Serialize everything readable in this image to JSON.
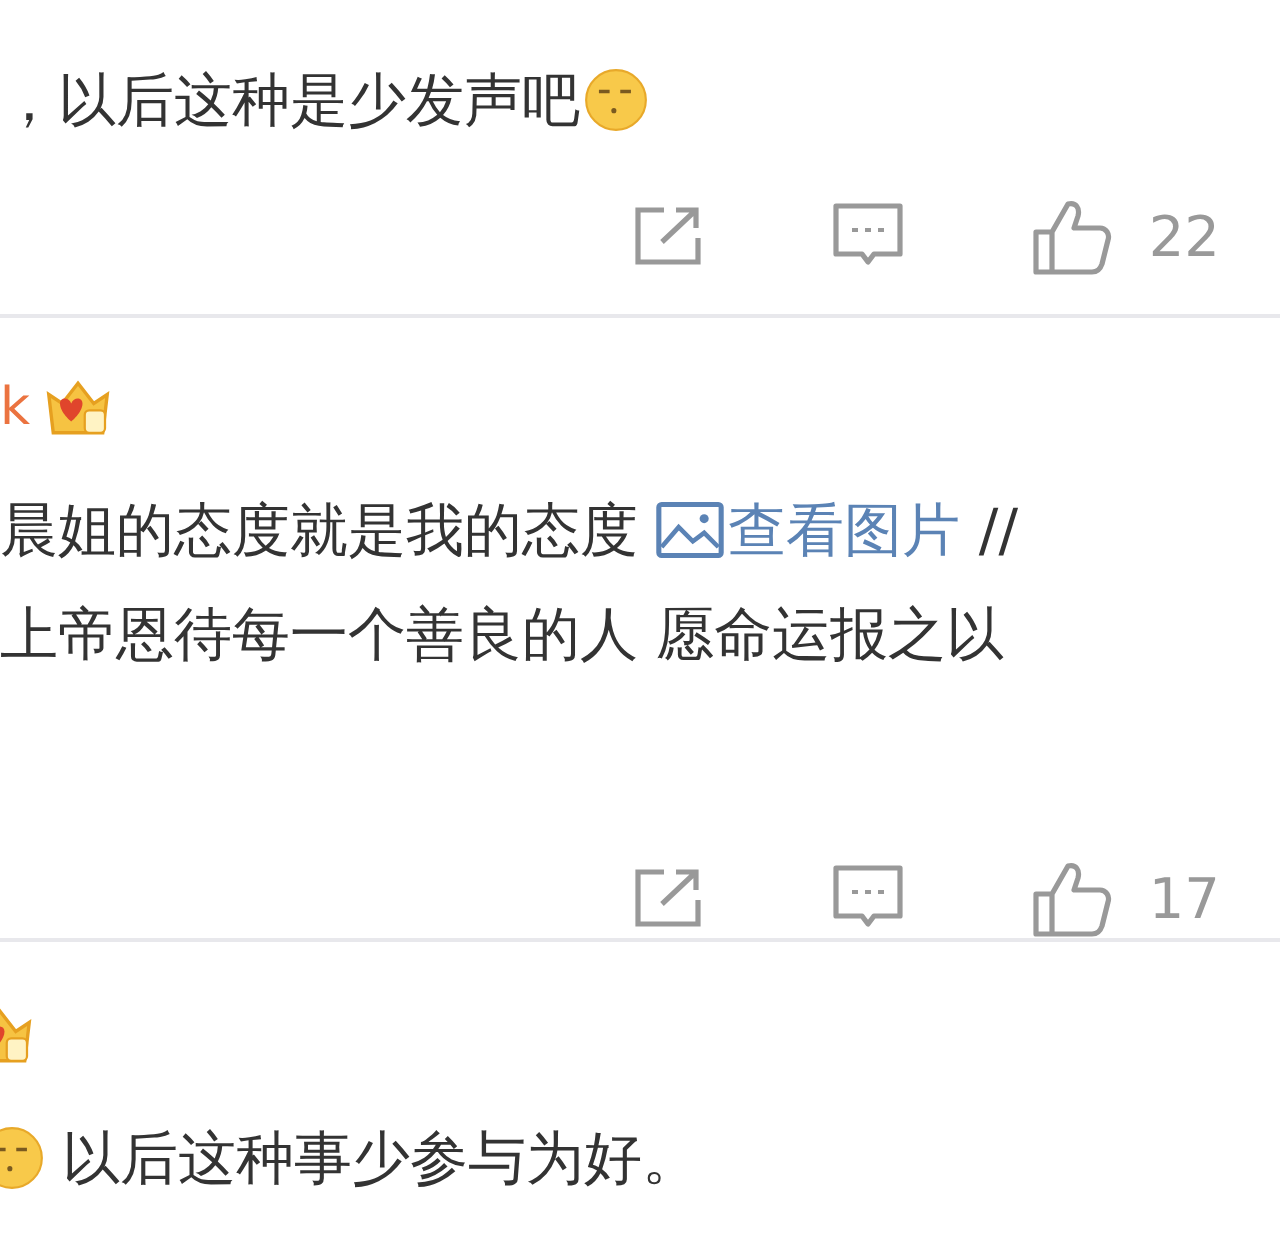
{
  "comments": [
    {
      "lines": [
        [
          {
            "kind": "text",
            "text": "，以后这种是少发声吧"
          },
          {
            "kind": "emoji"
          }
        ]
      ],
      "likes": "22"
    },
    {
      "author": "k",
      "badge": true,
      "lines": [
        [
          {
            "kind": "text",
            "text": "晨姐的态度就是我的态度 "
          },
          {
            "kind": "link",
            "text": "查看图片"
          },
          {
            "kind": "text",
            "text": " //"
          }
        ],
        [
          {
            "kind": "text",
            "text": "上帝恩待每一个善良的人 愿命运报之以"
          }
        ]
      ],
      "likes": "17"
    },
    {
      "badge": true,
      "lines": [
        [
          {
            "kind": "emoji"
          },
          {
            "kind": "text",
            "text": " 以后这种事少参与为好。"
          }
        ]
      ]
    }
  ]
}
